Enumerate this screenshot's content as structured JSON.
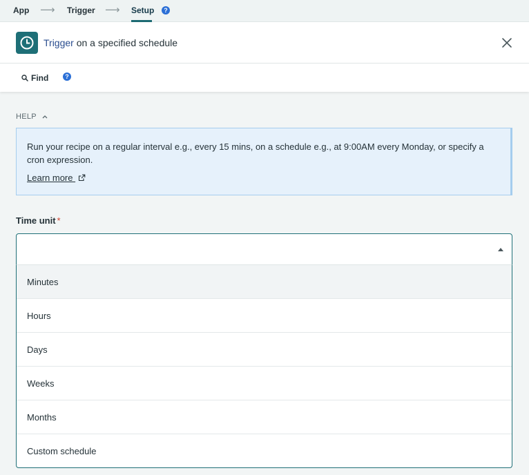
{
  "breadcrumb": {
    "app": "App",
    "trigger": "Trigger",
    "setup": "Setup",
    "separator_icon": "long-arrow-right-icon",
    "help_icon": "help-circle-icon",
    "help_glyph": "?"
  },
  "header": {
    "icon": "clock-icon",
    "title_link": "Trigger",
    "title_rest": " on a specified schedule",
    "close_icon": "close-icon"
  },
  "toolbar": {
    "find_label": "Find",
    "find_icon": "search-icon",
    "help_icon": "help-circle-icon",
    "help_glyph": "?"
  },
  "help": {
    "toggle_label": "HELP",
    "toggle_icon": "chevron-up-icon",
    "text": "Run your recipe on a regular interval e.g., every 15 mins, on a schedule e.g., at 9:00AM every Monday, or specify a cron expression.",
    "learn_more": "Learn more",
    "learn_more_icon": "external-link-icon"
  },
  "field": {
    "label": "Time unit",
    "required_mark": "*",
    "value": "",
    "caret_icon": "caret-up-icon"
  },
  "options": [
    "Minutes",
    "Hours",
    "Days",
    "Weeks",
    "Months",
    "Custom schedule"
  ],
  "colors": {
    "accent": "#1e6f77",
    "link": "#2a4d8f",
    "help_bg": "#e6f1fb",
    "required": "#d0412e"
  }
}
